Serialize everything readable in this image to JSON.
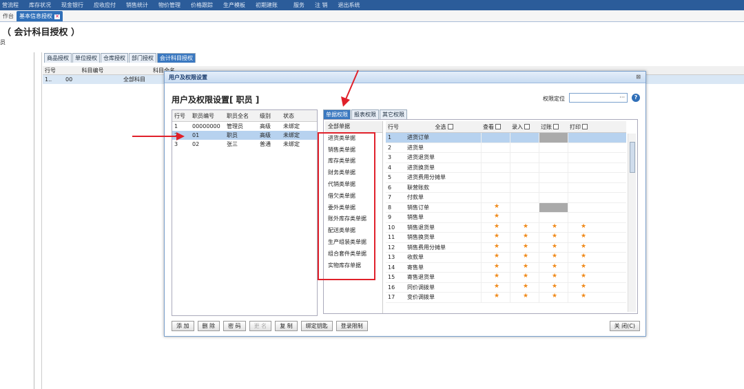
{
  "top_menu": [
    "营流程",
    "库存状况",
    "现金银行",
    "应收应付",
    "销售统计",
    "物价管理",
    "价格跟踪",
    "生产模板",
    "初期建账",
    "服务",
    "注 销",
    "退出系统"
  ],
  "tabs": {
    "workbench": "作台",
    "active": "基本信息授权"
  },
  "page": {
    "title": "（ 会计科目授权 ）",
    "sub": "员"
  },
  "sub_tabs": [
    "商品授权",
    "单位授权",
    "仓库授权",
    "部门授权",
    "会计科目授权"
  ],
  "bg_table": {
    "headers": [
      "行号",
      "科目编号",
      "科目全名"
    ],
    "row": [
      "1..",
      "00",
      "全部科目"
    ]
  },
  "dialog": {
    "title": "用户及权限设置",
    "close": "⊠",
    "heading": "用户及权限设置[ 职员 ]",
    "perm_locate_label": "权限定位",
    "perm_input_value": "···",
    "help": "?",
    "emp_headers": [
      "行号",
      "职员编号",
      "职员全名",
      "级别",
      "状态"
    ],
    "employees": [
      {
        "no": "1",
        "code": "00000000",
        "name": "管理员",
        "level": "高级",
        "status": "未绑定"
      },
      {
        "no": "2",
        "code": "01",
        "name": "职员",
        "level": "高级",
        "status": "未绑定"
      },
      {
        "no": "3",
        "code": "02",
        "name": "张三",
        "level": "普通",
        "status": "未绑定"
      }
    ],
    "perm_tabs": [
      "单据权限",
      "报表权限",
      "其它权限"
    ],
    "categories": [
      "全部单据",
      "进货类单据",
      "销售类单据",
      "库存类单据",
      "财务类单据",
      "代销类单据",
      "借欠类单据",
      "委外类单据",
      "账外库存类单据",
      "配送类单据",
      "生产组装类单据",
      "组合套件类单据",
      "实物库存单据"
    ],
    "doc_headers": {
      "no": "行号",
      "all": "全选",
      "view": "查看",
      "entry": "录入",
      "post": "过账",
      "print": "打印"
    },
    "docs": [
      {
        "no": "1",
        "name": "进货订单",
        "marks": [
          "",
          "",
          "g",
          ""
        ]
      },
      {
        "no": "2",
        "name": "进货单",
        "marks": [
          "",
          "",
          "",
          ""
        ]
      },
      {
        "no": "3",
        "name": "进货退货单",
        "marks": [
          "",
          "",
          "",
          ""
        ]
      },
      {
        "no": "4",
        "name": "进货换货单",
        "marks": [
          "",
          "",
          "",
          ""
        ]
      },
      {
        "no": "5",
        "name": "进货费用分摊单",
        "marks": [
          "",
          "",
          "",
          ""
        ]
      },
      {
        "no": "6",
        "name": "联营账款",
        "marks": [
          "",
          "",
          "",
          ""
        ]
      },
      {
        "no": "7",
        "name": "付款单",
        "marks": [
          "",
          "",
          "",
          ""
        ]
      },
      {
        "no": "8",
        "name": "销售订单",
        "marks": [
          "★",
          "",
          "g",
          ""
        ]
      },
      {
        "no": "9",
        "name": "销售单",
        "marks": [
          "★",
          "",
          "",
          ""
        ]
      },
      {
        "no": "10",
        "name": "销售退货单",
        "marks": [
          "★",
          "★",
          "★",
          "★"
        ]
      },
      {
        "no": "11",
        "name": "销售换货单",
        "marks": [
          "★",
          "★",
          "★",
          "★"
        ]
      },
      {
        "no": "12",
        "name": "销售费用分摊单",
        "marks": [
          "★",
          "★",
          "★",
          "★"
        ]
      },
      {
        "no": "13",
        "name": "收款单",
        "marks": [
          "★",
          "★",
          "★",
          "★"
        ]
      },
      {
        "no": "14",
        "name": "寄售单",
        "marks": [
          "★",
          "★",
          "★",
          "★"
        ]
      },
      {
        "no": "15",
        "name": "寄售退货单",
        "marks": [
          "★",
          "★",
          "★",
          "★"
        ]
      },
      {
        "no": "16",
        "name": "同价调拨单",
        "marks": [
          "★",
          "★",
          "★",
          "★"
        ]
      },
      {
        "no": "17",
        "name": "变价调拨单",
        "marks": [
          "★",
          "★",
          "★",
          "★"
        ]
      }
    ],
    "buttons": {
      "add": "添 加",
      "delete": "删 除",
      "password": "密 码",
      "rename": "更 名",
      "copy": "复 制",
      "bind_key": "绑定钥匙",
      "login_limit": "登录限制",
      "close": "关 闭(C)"
    }
  },
  "colors": {
    "accent": "#2f6fb8",
    "highlight": "#e0202a",
    "star": "#f08a1a"
  }
}
